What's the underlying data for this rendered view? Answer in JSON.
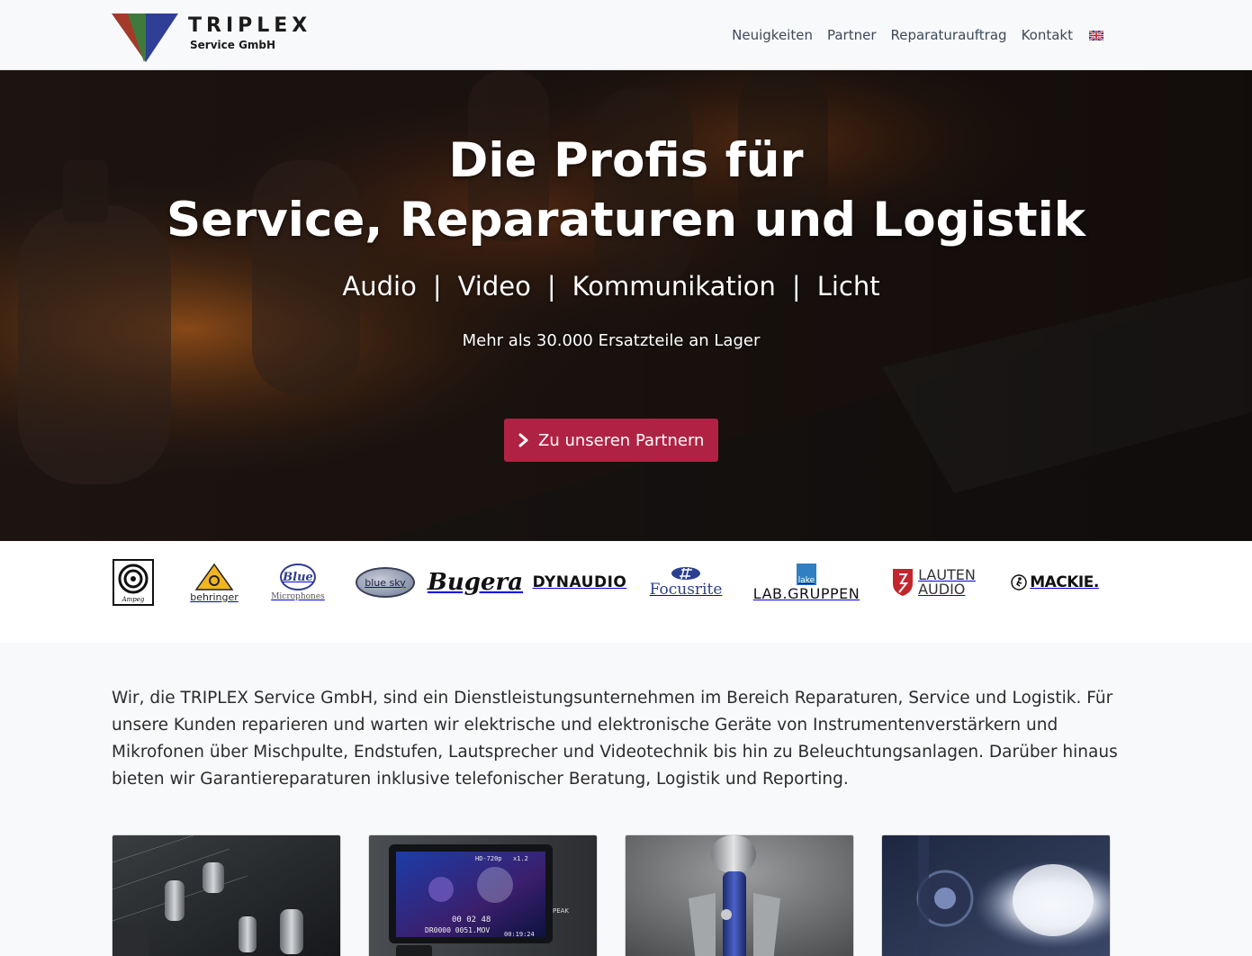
{
  "brand": {
    "title": "TRIPLEX",
    "subtitle": "Service GmbH",
    "colors": {
      "red": "#a33a2a",
      "green": "#3f7a3c",
      "blue": "#2f3f95"
    }
  },
  "nav": {
    "items": [
      {
        "label": "Neuigkeiten"
      },
      {
        "label": "Partner"
      },
      {
        "label": "Reparaturauftrag"
      },
      {
        "label": "Kontakt"
      }
    ],
    "language_icon": "uk-flag-icon"
  },
  "hero": {
    "title_line1": "Die Profis für",
    "title_line2": "Service, Reparaturen und Logistik",
    "categories": [
      "Audio",
      "Video",
      "Kommunikation",
      "Licht"
    ],
    "separator": "|",
    "stock_note": "Mehr als 30.000 Ersatzteile an Lager",
    "cta_label": "Zu unseren Partnern",
    "cta_icon": "chevron-right-icon",
    "cta_color": "#b02243"
  },
  "brands": {
    "ampeg": "Ampeg",
    "behringer": "behringer",
    "blue_main": "Blue",
    "blue_sub": "Microphones",
    "bluesky": "blue sky",
    "bugera": "Bugera",
    "dynaudio": "DYNAUDIO",
    "focusrite": "Focusrite",
    "lab_top": "lake",
    "lab_main": "LAB.GRUPPEN",
    "lauten_top": "LAUTEN",
    "lauten_bottom": "AUDIO",
    "mackie": "MACKIE."
  },
  "intro": {
    "text": "Wir, die TRIPLEX Service GmbH, sind ein Dienstleistungsunternehmen im Bereich Reparaturen, Service und Logistik. Für unsere Kunden reparieren und warten wir elektrische und elektronische Geräte von Instrumentenverstärkern und Mikrofonen über Mischpulte, Endstufen, Lautsprecher und Videotechnik bis hin zu Beleuchtungsanlagen. Darüber hinaus bieten wir Garantiereparaturen inklusive telefonischer Beratung, Logistik und Reporting."
  },
  "cards": {
    "video_label": "HD-720p",
    "video_zoom": "x1.2",
    "video_peak": "PEAK",
    "video_counter": "00 02 48",
    "video_file": "DR0000 0051.MOV",
    "video_time": "00:19:24"
  }
}
